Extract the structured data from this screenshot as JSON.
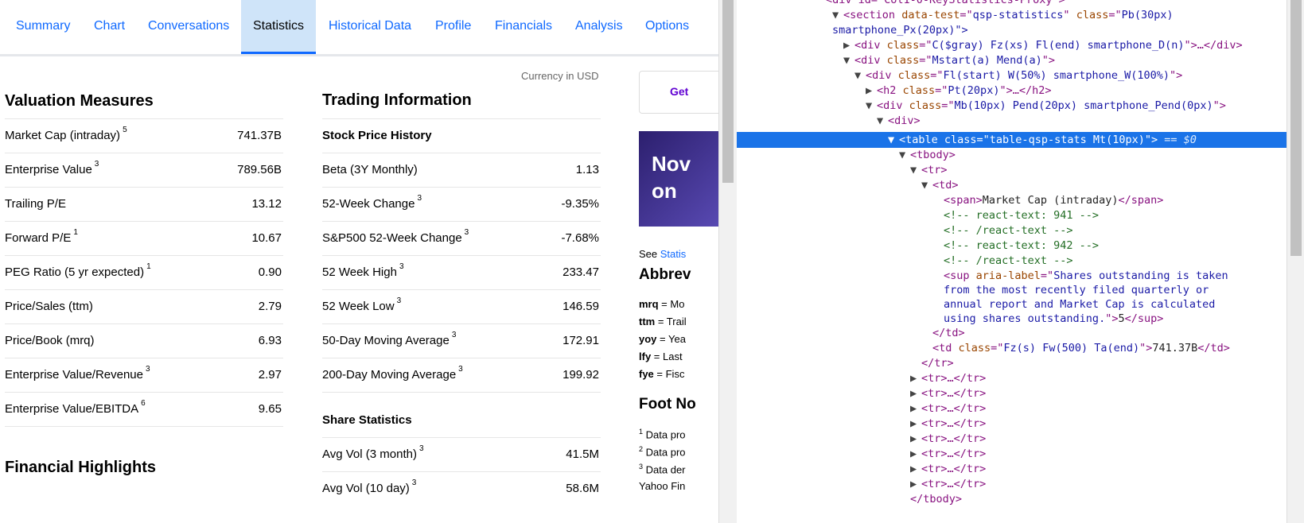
{
  "tabs": [
    "Summary",
    "Chart",
    "Conversations",
    "Statistics",
    "Historical Data",
    "Profile",
    "Financials",
    "Analysis",
    "Options"
  ],
  "currency_note": "Currency in USD",
  "valuation": {
    "title": "Valuation Measures",
    "rows": [
      {
        "label": "Market Cap (intraday)",
        "sup": "5",
        "value": "741.37B"
      },
      {
        "label": "Enterprise Value",
        "sup": "3",
        "value": "789.56B"
      },
      {
        "label": "Trailing P/E",
        "sup": "",
        "value": "13.12"
      },
      {
        "label": "Forward P/E",
        "sup": "1",
        "value": "10.67"
      },
      {
        "label": "PEG Ratio (5 yr expected)",
        "sup": "1",
        "value": "0.90"
      },
      {
        "label": "Price/Sales (ttm)",
        "sup": "",
        "value": "2.79"
      },
      {
        "label": "Price/Book (mrq)",
        "sup": "",
        "value": "6.93"
      },
      {
        "label": "Enterprise Value/Revenue",
        "sup": "3",
        "value": "2.97"
      },
      {
        "label": "Enterprise Value/EBITDA",
        "sup": "6",
        "value": "9.65"
      }
    ]
  },
  "financial_title": "Financial Highlights",
  "trading": {
    "title": "Trading Information",
    "history_title": "Stock Price History",
    "rows": [
      {
        "label": "Beta (3Y Monthly)",
        "sup": "",
        "value": "1.13"
      },
      {
        "label": "52-Week Change",
        "sup": "3",
        "value": "-9.35%"
      },
      {
        "label": "S&P500 52-Week Change",
        "sup": "3",
        "value": "-7.68%"
      },
      {
        "label": "52 Week High",
        "sup": "3",
        "value": "233.47"
      },
      {
        "label": "52 Week Low",
        "sup": "3",
        "value": "146.59"
      },
      {
        "label": "50-Day Moving Average",
        "sup": "3",
        "value": "172.91"
      },
      {
        "label": "200-Day Moving Average",
        "sup": "3",
        "value": "199.92"
      }
    ],
    "share_title": "Share Statistics",
    "share_rows": [
      {
        "label": "Avg Vol (3 month)",
        "sup": "3",
        "value": "41.5M"
      },
      {
        "label": "Avg Vol (10 day)",
        "sup": "3",
        "value": "58.6M"
      }
    ]
  },
  "rightcol": {
    "button_text": "Get",
    "promo_text_1": "Nov",
    "promo_text_2": "on",
    "see_prefix": "See ",
    "see_link": "Statis",
    "abbrev_title": "Abbrev",
    "abbrevs": [
      {
        "key": "mrq",
        "text": " = Mo"
      },
      {
        "key": "ttm",
        "text": " = Trail"
      },
      {
        "key": "yoy",
        "text": " = Yea"
      },
      {
        "key": "lfy",
        "text": " = Last"
      },
      {
        "key": "fye",
        "text": " = Fisc"
      }
    ],
    "foot_title": "Foot No",
    "foot_lines": [
      {
        "sup": "1",
        "text": "Data pro"
      },
      {
        "sup": "2",
        "text": "Data pro"
      },
      {
        "sup": "3",
        "text": "Data der"
      },
      {
        "sup": "",
        "text": "Yahoo Fin"
      }
    ]
  },
  "devtools": {
    "l0": "<div id=\"Col1-0-KeyStatistics-Proxy\">",
    "l1_tag": "section",
    "l1_attr1": "data-test",
    "l1_val1": "qsp-statistics",
    "l1_attr2": "class",
    "l1_val2": "Pb(30px)",
    "l2": "smartphone_Px(20px)\">",
    "l3_val": "C($gray) Fz(xs) Fl(end) smartphone_D(n)",
    "l4_val": "Mstart(a) Mend(a)",
    "l5_val": "Fl(start) W(50%) smartphone_W(100%)",
    "l6_val": "Pt(20px)",
    "l7_val": "Mb(10px) Pend(20px) smartphone_Pend(0px)",
    "sel_val": "table-qsp-stats Mt(10px)",
    "sel_suffix": " == $0",
    "span_text": "Market Cap (intraday)",
    "comments": [
      "<!-- react-text: 941 -->",
      "<!-- /react-text -->",
      "<!-- react-text: 942 -->",
      "<!-- /react-text -->"
    ],
    "sup_label": "Shares outstanding is taken",
    "sup_l2": "from the most recently filed quarterly or",
    "sup_l3": "annual report and Market Cap is calculated",
    "sup_l4": "using shares outstanding.",
    "sup_num": "5",
    "td2_val": "Fz(s) Fw(500) Ta(end)",
    "td2_text": "741.37B",
    "tr_collapsed": "<tr>…</tr>",
    "tbody_close": "</tbody>"
  }
}
